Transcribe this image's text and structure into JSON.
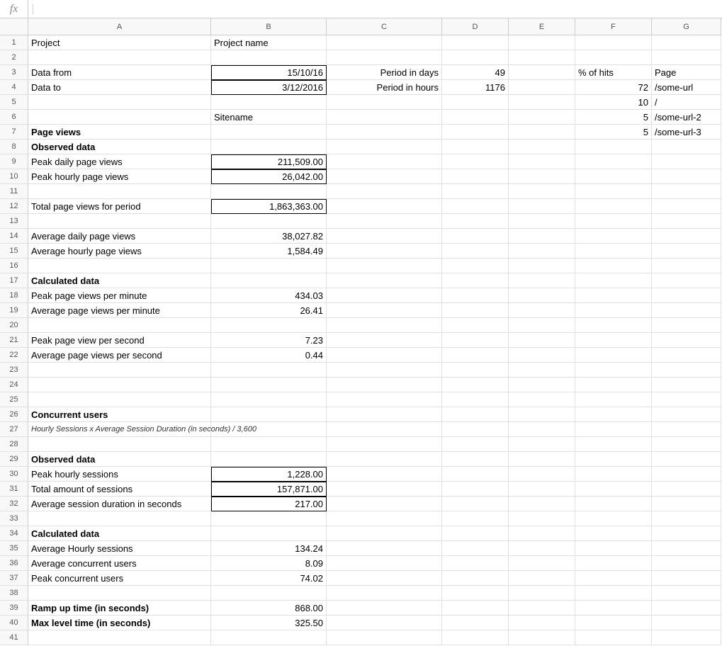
{
  "formula_bar": {
    "fx": "fx",
    "value": ""
  },
  "columns": [
    "A",
    "B",
    "C",
    "D",
    "E",
    "F",
    "G"
  ],
  "row_count": 41,
  "cells": {
    "A1": "Project",
    "B1": "Project name",
    "A3": "Data from",
    "B3": "15/10/16",
    "C3": "Period in days",
    "D3": "49",
    "F3": "% of hits",
    "G3": "Page",
    "A4": "Data to",
    "B4": "3/12/2016",
    "C4": "Period in hours",
    "D4": "1176",
    "F4": "72",
    "G4": "/some-url",
    "F5": "10",
    "G5": "/",
    "B6": "Sitename",
    "F6": "5",
    "G6": "/some-url-2",
    "A7": "Page views",
    "F7": "5",
    "G7": "/some-url-3",
    "A8": "Observed data",
    "A9": "Peak daily page views",
    "B9": "211,509.00",
    "A10": "Peak hourly page views",
    "B10": "26,042.00",
    "A12": "Total page views for period",
    "B12": "1,863,363.00",
    "A14": "Average daily page views",
    "B14": "38,027.82",
    "A15": "Average hourly page views",
    "B15": "1,584.49",
    "A17": "Calculated data",
    "A18": "Peak page views per minute",
    "B18": "434.03",
    "A19": "Average page views per minute",
    "B19": "26.41",
    "A21": "Peak page view per second",
    "B21": "7.23",
    "A22": "Average page views per second",
    "B22": "0.44",
    "A26": "Concurrent users",
    "A27": "Hourly Sessions x Average Session Duration (in seconds) / 3,600",
    "A29": "Observed data",
    "A30": "Peak hourly sessions",
    "B30": "1,228.00",
    "A31": "Total amount of sessions",
    "B31": "157,871.00",
    "A32": "Average session duration in seconds",
    "B32": "217.00",
    "A34": "Calculated data",
    "A35": "Average Hourly sessions",
    "B35": "134.24",
    "A36": "Average concurrent users",
    "B36": "8.09",
    "A37": "Peak concurrent users",
    "B37": "74.02",
    "A39": "Ramp up time (in seconds)",
    "B39": "868.00",
    "A40": "Max level time (in seconds)",
    "B40": "325.50"
  },
  "bold_cells": [
    "A7",
    "A8",
    "A17",
    "A26",
    "A29",
    "A34",
    "A39",
    "A40"
  ],
  "italic_cells": [
    "A27"
  ],
  "boxed_cells": [
    "B3",
    "B4",
    "B9",
    "B10",
    "B12",
    "B30",
    "B31",
    "B32"
  ],
  "num_cells": [
    "B3",
    "B4",
    "D3",
    "D4",
    "F4",
    "F5",
    "F6",
    "F7",
    "B9",
    "B10",
    "B12",
    "B14",
    "B15",
    "B18",
    "B19",
    "B21",
    "B22",
    "B30",
    "B31",
    "B32",
    "B35",
    "B36",
    "B37",
    "B39",
    "B40",
    "C3",
    "C4"
  ],
  "right_cells": [
    "C3",
    "C4"
  ],
  "overflow_cells": [
    "A27",
    "A32",
    "A19",
    "A22"
  ]
}
